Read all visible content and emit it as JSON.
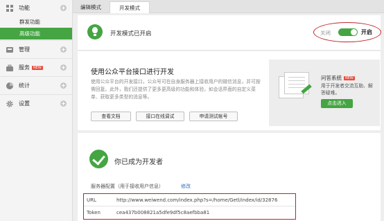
{
  "sidebar": {
    "groups": [
      {
        "label": "功能",
        "icon": "grid-icon"
      },
      {
        "label": "管理",
        "icon": "inbox-icon"
      },
      {
        "label": "服务",
        "icon": "briefcase-icon",
        "badge": "NEW"
      },
      {
        "label": "统计",
        "icon": "pie-chart-icon"
      },
      {
        "label": "设置",
        "icon": "gear-icon"
      }
    ],
    "sub_items": [
      {
        "label": "群发功能"
      },
      {
        "label": "高级功能"
      }
    ]
  },
  "tabs": [
    {
      "label": "编辑模式"
    },
    {
      "label": "开发模式"
    }
  ],
  "dev_mode": {
    "status_text": "开发模式已开启",
    "toggle_off_label": "关闭",
    "toggle_on_label": "开启",
    "toggle_state": "on"
  },
  "api_section": {
    "title": "使用公众平台接口进行开发",
    "description": "使用公众平台的开发接口，公众号可在自身服务器上接收用户的微信消息，并可按需回复。此外，我们还提供了更多更高级的功能和体验，如会话界面的自定义菜单、获取更多类型的消息等。",
    "buttons": [
      {
        "label": "查看文档"
      },
      {
        "label": "接口在线调试"
      },
      {
        "label": "申请测试帐号"
      }
    ]
  },
  "qa_card": {
    "title": "问答系统",
    "badge": "NEW",
    "description": "用于开发者交流互助、解答疑难。",
    "button_label": "点击进入"
  },
  "developer": {
    "title": "你已成为开发者",
    "config_label": "服务器配置（用于接收用户信息）",
    "edit_label": "修改",
    "config_rows": [
      {
        "key": "URL",
        "value": "http://www.weiwend.com/index.php?s=/home/Getl/index/id/32876"
      },
      {
        "key": "Token",
        "value": "cea437b008821a5dfe9df5c8aefbba81"
      }
    ]
  },
  "colors": {
    "accent": "#44a542",
    "highlight_ring": "#c0262b",
    "link": "#2c6fb7"
  }
}
